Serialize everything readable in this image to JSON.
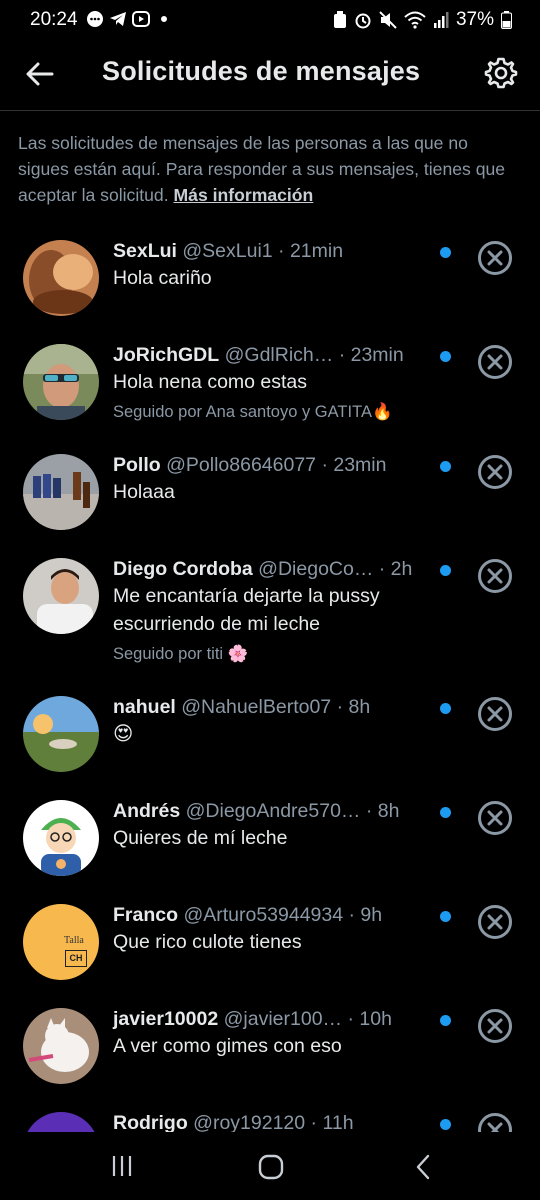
{
  "status": {
    "time": "20:24",
    "battery": "37%"
  },
  "header": {
    "title": "Solicitudes de mensajes"
  },
  "info": {
    "text": "Las solicitudes de mensajes de las personas a las que no sigues están aquí. Para responder a sus mensajes, tienes que aceptar la solicitud.",
    "link": "Más información"
  },
  "requests": [
    {
      "name": "SexLui",
      "handle": "@SexLui1",
      "time": "· 21min",
      "message": "Hola cariño",
      "followed_by": ""
    },
    {
      "name": "JoRichGDL",
      "handle": "@GdlRich…",
      "time": "· 23min",
      "message": "Hola nena como estas",
      "followed_by": "Seguido por Ana santoyo y GATITA🔥"
    },
    {
      "name": "Pollo",
      "handle": "@Pollo86646077",
      "time": "· 23min",
      "message": "Holaaa",
      "followed_by": ""
    },
    {
      "name": "Diego Cordoba",
      "handle": "@DiegoCo…",
      "time": "· 2h",
      "message": "Me encantaría dejarte la pussy escurriendo de mi leche",
      "followed_by": "Seguido por titi 🌸"
    },
    {
      "name": "nahuel",
      "handle": "@NahuelBerto07",
      "time": "· 8h",
      "message": "😍",
      "followed_by": ""
    },
    {
      "name": "Andrés",
      "handle": "@DiegoAndre570…",
      "time": "· 8h",
      "message": "Quieres de mí leche",
      "followed_by": ""
    },
    {
      "name": "Franco",
      "handle": "@Arturo53944934",
      "time": "· 9h",
      "message": "Que rico culote tienes",
      "followed_by": ""
    },
    {
      "name": "javier10002",
      "handle": "@javier100…",
      "time": "· 10h",
      "message": "A ver como gimes con eso",
      "followed_by": ""
    },
    {
      "name": "Rodrigo",
      "handle": "@roy192120",
      "time": "· 11h",
      "message": "",
      "followed_by": ""
    }
  ],
  "avatar_text": {
    "franco_line1": "Talla",
    "franco_line2": "CH"
  },
  "colors": {
    "accent": "#1d9bf0",
    "secondary_text": "#8b98a5",
    "background": "#000000"
  }
}
